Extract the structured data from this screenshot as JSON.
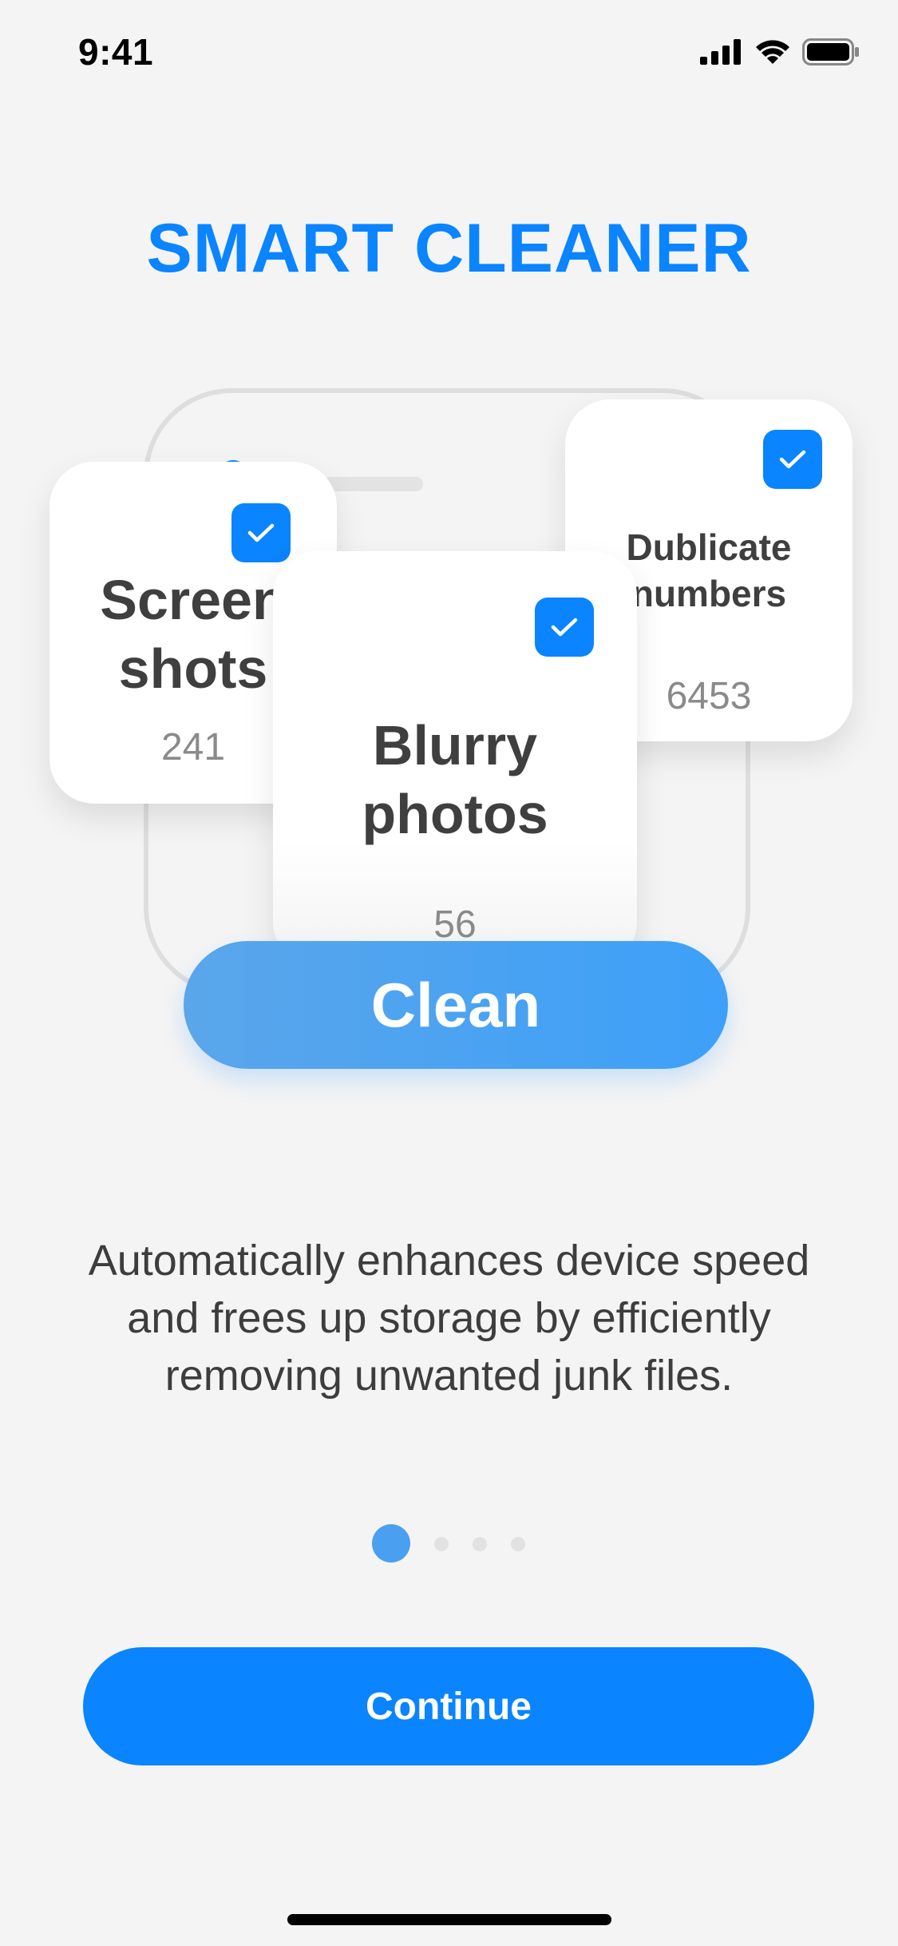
{
  "status_bar": {
    "time": "9:41",
    "icons": [
      "signal-icon",
      "wifi-icon",
      "battery-icon"
    ]
  },
  "title": "SMART CLEANER",
  "cards": {
    "screenshots": {
      "label_line1": "Screen",
      "label_line2": "shots",
      "count": "241",
      "checked": true
    },
    "blurry": {
      "label_line1": "Blurry",
      "label_line2": "photos",
      "count": "56",
      "checked": true
    },
    "duplicate": {
      "label_line1": "Dublicate",
      "label_line2": "numbers",
      "count": "6453",
      "checked": true
    }
  },
  "clean_button": {
    "label": "Clean"
  },
  "description": {
    "line1": "Automatically enhances device speed",
    "line2": "and frees up storage by efficiently",
    "line3": "removing unwanted junk files."
  },
  "pager": {
    "current_page": 1,
    "total_pages": 4
  },
  "continue_button": {
    "label": "Continue"
  },
  "colors": {
    "accent": "#0a84ff",
    "background": "#f4f4f4",
    "card": "#ffffff",
    "text_dark": "#3f3f3f",
    "text_muted": "#8a8a8a"
  }
}
